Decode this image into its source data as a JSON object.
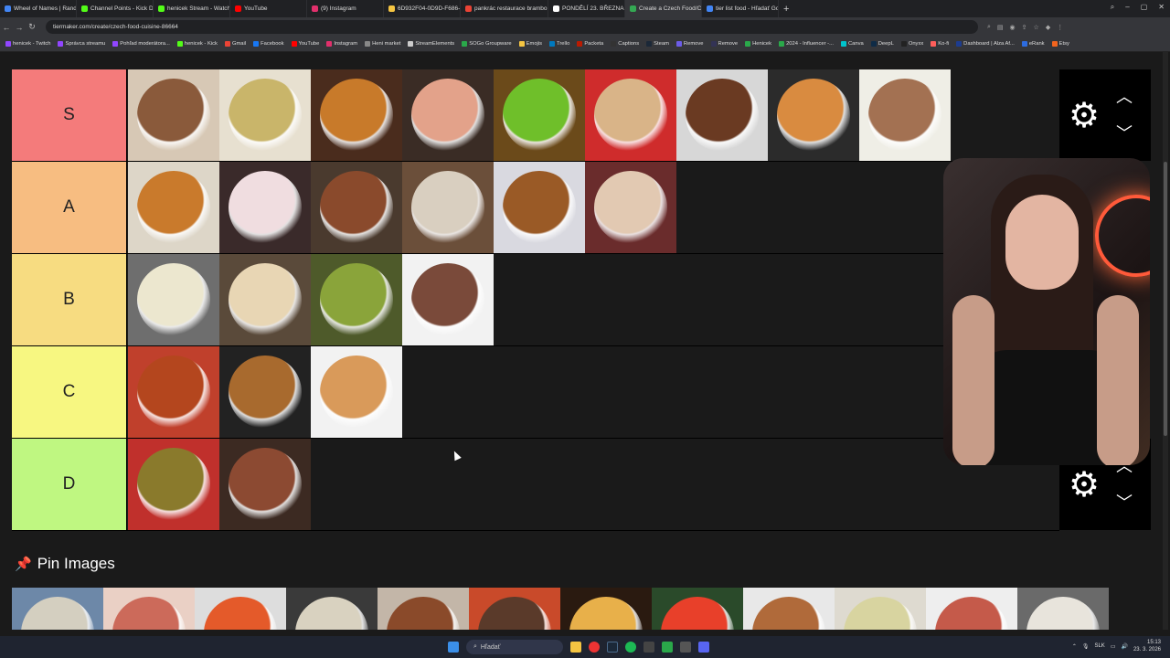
{
  "browser": {
    "tabs": [
      {
        "title": "Wheel of Names | Random",
        "color": "#4285f4"
      },
      {
        "title": "Channel Points - Kick Das",
        "color": "#53fc18"
      },
      {
        "title": "henicek Stream - Watch Li",
        "color": "#53fc18"
      },
      {
        "title": "YouTube",
        "color": "#ff0000"
      },
      {
        "title": "(9) Instagram",
        "color": "#e1306c"
      },
      {
        "title": "6D932F04-0D9D-F686-28",
        "color": "#f5c542"
      },
      {
        "title": "pankrác restaurace brambo",
        "color": "#ea4335"
      },
      {
        "title": "PONDĚLÍ 23. BŘEZNA",
        "color": "#ffffff"
      },
      {
        "title": "Create a Czech Food/Cuisi",
        "color": "#34a853",
        "active": true
      },
      {
        "title": "tier list food - Hľadať Goo",
        "color": "#4285f4"
      }
    ],
    "url": "tiermaker.com/create/czech-food-cuisine-86664",
    "bookmarks": [
      {
        "label": "henicek - Twitch",
        "color": "#9146ff"
      },
      {
        "label": "Správca streamu",
        "color": "#9146ff"
      },
      {
        "label": "Pohľad moderátora...",
        "color": "#9146ff"
      },
      {
        "label": "henicek - Kick",
        "color": "#53fc18"
      },
      {
        "label": "Gmail",
        "color": "#ea4335"
      },
      {
        "label": "Facebook",
        "color": "#1877f2"
      },
      {
        "label": "YouTube",
        "color": "#ff0000"
      },
      {
        "label": "Instagram",
        "color": "#e1306c"
      },
      {
        "label": "Heni market",
        "color": "#888888"
      },
      {
        "label": "StreamElements",
        "color": "#cccccc"
      },
      {
        "label": "SOGo Groupware",
        "color": "#2aa84a"
      },
      {
        "label": "Emojis",
        "color": "#f5c542"
      },
      {
        "label": "Trello",
        "color": "#0079bf"
      },
      {
        "label": "Packeta",
        "color": "#ba1b02"
      },
      {
        "label": "Captions",
        "color": "#333333"
      },
      {
        "label": "Steam",
        "color": "#1b2838"
      },
      {
        "label": "Remove",
        "color": "#6c5ce7"
      },
      {
        "label": "Remove",
        "color": "#333355"
      },
      {
        "label": "Henicek",
        "color": "#2aa84a"
      },
      {
        "label": "2024 - Influencer -...",
        "color": "#2aa84a"
      },
      {
        "label": "Canva",
        "color": "#00c4cc"
      },
      {
        "label": "DeepL",
        "color": "#0f2b46"
      },
      {
        "label": "Onyxx",
        "color": "#222222"
      },
      {
        "label": "Ko-fi",
        "color": "#ff5e5b"
      },
      {
        "label": "Dashboard | Alza Af...",
        "color": "#1d3c8f"
      },
      {
        "label": "eRank",
        "color": "#2d6cdf"
      },
      {
        "label": "Etsy",
        "color": "#f1641e"
      }
    ]
  },
  "tierlist": {
    "tiers": [
      {
        "label": "S",
        "color": "#f47b7b",
        "items": [
          {
            "name": "babovka-cake",
            "bg": "#d7c8b5",
            "food": "#8a5a3b"
          },
          {
            "name": "potato-soup",
            "bg": "#e7e0d0",
            "food": "#c9b56a"
          },
          {
            "name": "fried-cauliflower",
            "bg": "#4a2c1d",
            "food": "#c87a2a"
          },
          {
            "name": "open-sandwiches",
            "bg": "#3a2c25",
            "food": "#e3a28a"
          },
          {
            "name": "pea-soup",
            "bg": "#6b4a1a",
            "food": "#6fbf2a"
          },
          {
            "name": "fried-cheese",
            "bg": "#cf2c2c",
            "food": "#d9b488"
          },
          {
            "name": "meat-patties",
            "bg": "#d7d7d7",
            "food": "#6a3a22"
          },
          {
            "name": "donuts",
            "bg": "#2b2b2b",
            "food": "#d98b40"
          },
          {
            "name": "svickova",
            "bg": "#efeee6",
            "food": "#a37152"
          }
        ]
      },
      {
        "label": "A",
        "color": "#f7bd81",
        "items": [
          {
            "name": "potato-pancakes",
            "bg": "#ddd6c8",
            "food": "#c97a2c"
          },
          {
            "name": "fruit-buns",
            "bg": "#3a2a2a",
            "food": "#f0dde0"
          },
          {
            "name": "goulash-dumplings",
            "bg": "#4a3a2e",
            "food": "#8a4a2c"
          },
          {
            "name": "mushroom-soup",
            "bg": "#6b4f3a",
            "food": "#d9cfc0"
          },
          {
            "name": "duck-cabbage",
            "bg": "#d9d9e0",
            "food": "#9a5a26"
          },
          {
            "name": "apple-chips",
            "bg": "#6a2c2c",
            "food": "#e2c9b2"
          }
        ]
      },
      {
        "label": "B",
        "color": "#f7dc81",
        "items": [
          {
            "name": "fruit-dumplings",
            "bg": "#6e6e6e",
            "food": "#ece7cf"
          },
          {
            "name": "buchty",
            "bg": "#5a4a3a",
            "food": "#e8d6b4"
          },
          {
            "name": "garlic-soup",
            "bg": "#4e5a2a",
            "food": "#8aa43a"
          },
          {
            "name": "poppyseed-dessert",
            "bg": "#f2f2f2",
            "food": "#7a4a3a"
          }
        ]
      },
      {
        "label": "C",
        "color": "#f7f781",
        "items": [
          {
            "name": "bean-soup",
            "bg": "#c0402c",
            "food": "#b4461e"
          },
          {
            "name": "fried-chicken",
            "bg": "#222222",
            "food": "#a86a2e"
          },
          {
            "name": "chicken-paprika",
            "bg": "#f2f2f2",
            "food": "#d99a5a"
          }
        ]
      },
      {
        "label": "D",
        "color": "#bff781",
        "items": [
          {
            "name": "lentil-soup",
            "bg": "#c0302c",
            "food": "#8a7a2c"
          },
          {
            "name": "tripe-soup",
            "bg": "#3c2a22",
            "food": "#8c4a32"
          }
        ]
      }
    ]
  },
  "pin": {
    "title": "Pin Images",
    "items": [
      {
        "name": "pin-1",
        "bg": "#6d88a8",
        "food": "#d4cfc0"
      },
      {
        "name": "pin-2",
        "bg": "#ead0c5",
        "food": "#cc6a5a"
      },
      {
        "name": "pin-3",
        "bg": "#ddd",
        "food": "#e45a2a"
      },
      {
        "name": "pin-4",
        "bg": "#3a3a3a",
        "food": "#d9d2c0"
      },
      {
        "name": "pin-5",
        "bg": "#c3b6a8",
        "food": "#8a4a2a"
      },
      {
        "name": "pin-6",
        "bg": "#c94a2a",
        "food": "#5a3a2a"
      },
      {
        "name": "pin-7",
        "bg": "#2a1a10",
        "food": "#e8b04a"
      },
      {
        "name": "pin-8",
        "bg": "#2a4a2a",
        "food": "#e8402a"
      },
      {
        "name": "pin-9",
        "bg": "#e8e8e8",
        "food": "#b06a3a"
      },
      {
        "name": "pin-10",
        "bg": "#dedad0",
        "food": "#d8d4a0"
      },
      {
        "name": "pin-11",
        "bg": "#eee",
        "food": "#c55a4a"
      },
      {
        "name": "pin-12",
        "bg": "#6a6a6a",
        "food": "#e8e4dc"
      }
    ]
  },
  "taskbar": {
    "search_placeholder": "Hľadať",
    "lang": "SLK",
    "time": "15:13",
    "date": "23. 3. 2026"
  }
}
